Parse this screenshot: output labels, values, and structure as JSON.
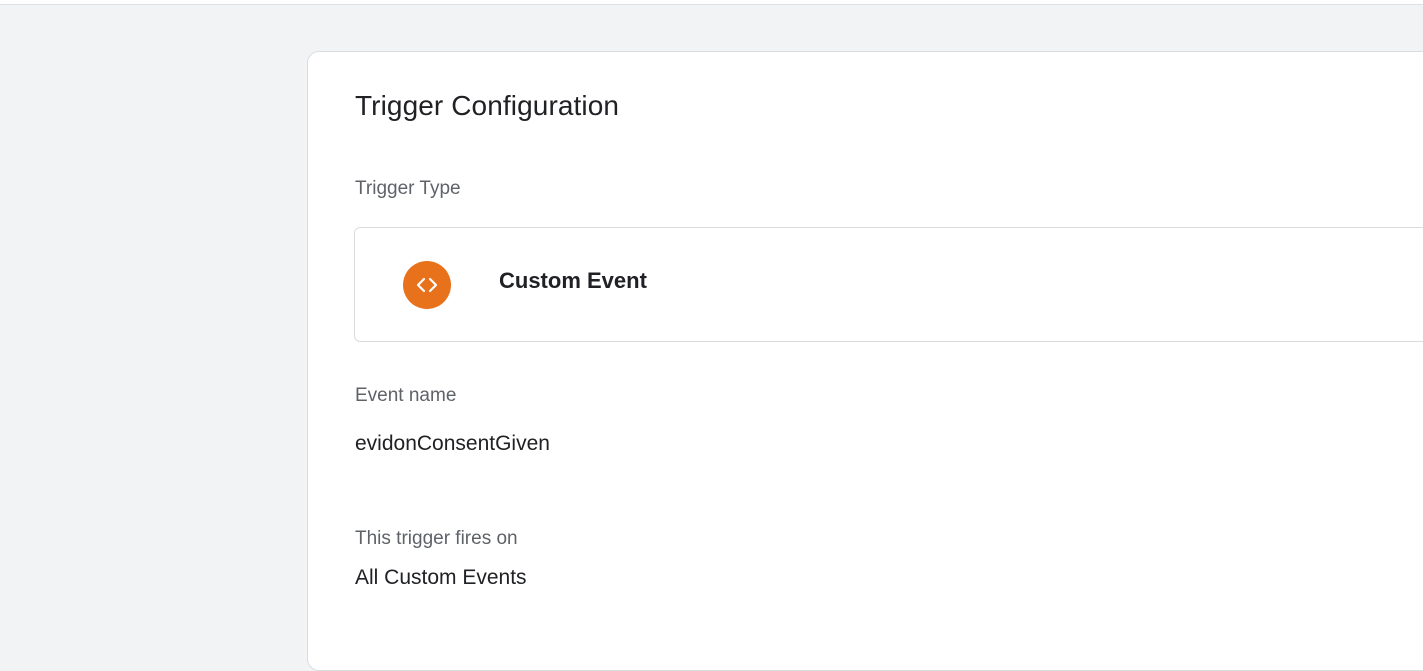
{
  "trigger_config": {
    "title": "Trigger Configuration",
    "trigger_type_label": "Trigger Type",
    "trigger_type": {
      "name": "Custom Event",
      "icon": "code-brackets-icon",
      "icon_color": "#e8711c"
    },
    "event_name_label": "Event name",
    "event_name_value": "evidonConsentGiven",
    "fires_on_label": "This trigger fires on",
    "fires_on_value": "All Custom Events"
  }
}
